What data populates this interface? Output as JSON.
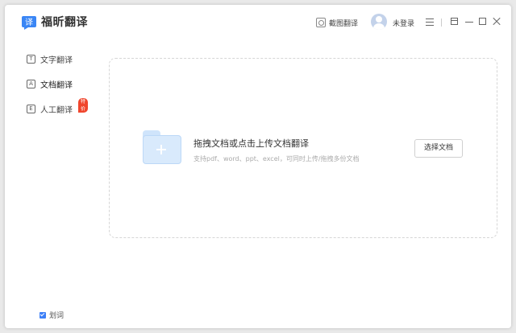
{
  "app": {
    "logo_text": "译",
    "title": "福昕翻译"
  },
  "header": {
    "screenshot_label": "截图翻译",
    "login_label": "未登录"
  },
  "sidebar": {
    "items": [
      {
        "icon_text": "T",
        "label": "文字翻译"
      },
      {
        "icon_text": "A",
        "label": "文档翻译"
      },
      {
        "icon_text": "E",
        "label": "人工翻译",
        "badge": "特价"
      }
    ],
    "bottom_checkbox_label": "划词"
  },
  "main": {
    "drop_title": "拖拽文档或点击上传文档翻译",
    "drop_subtitle": "支持pdf、word、ppt、excel，可同时上传/拖拽多份文档",
    "select_button": "选择文档"
  },
  "colors": {
    "accent": "#3d7ff7",
    "badge": "#f0462d",
    "folder": "#d9eafc"
  }
}
